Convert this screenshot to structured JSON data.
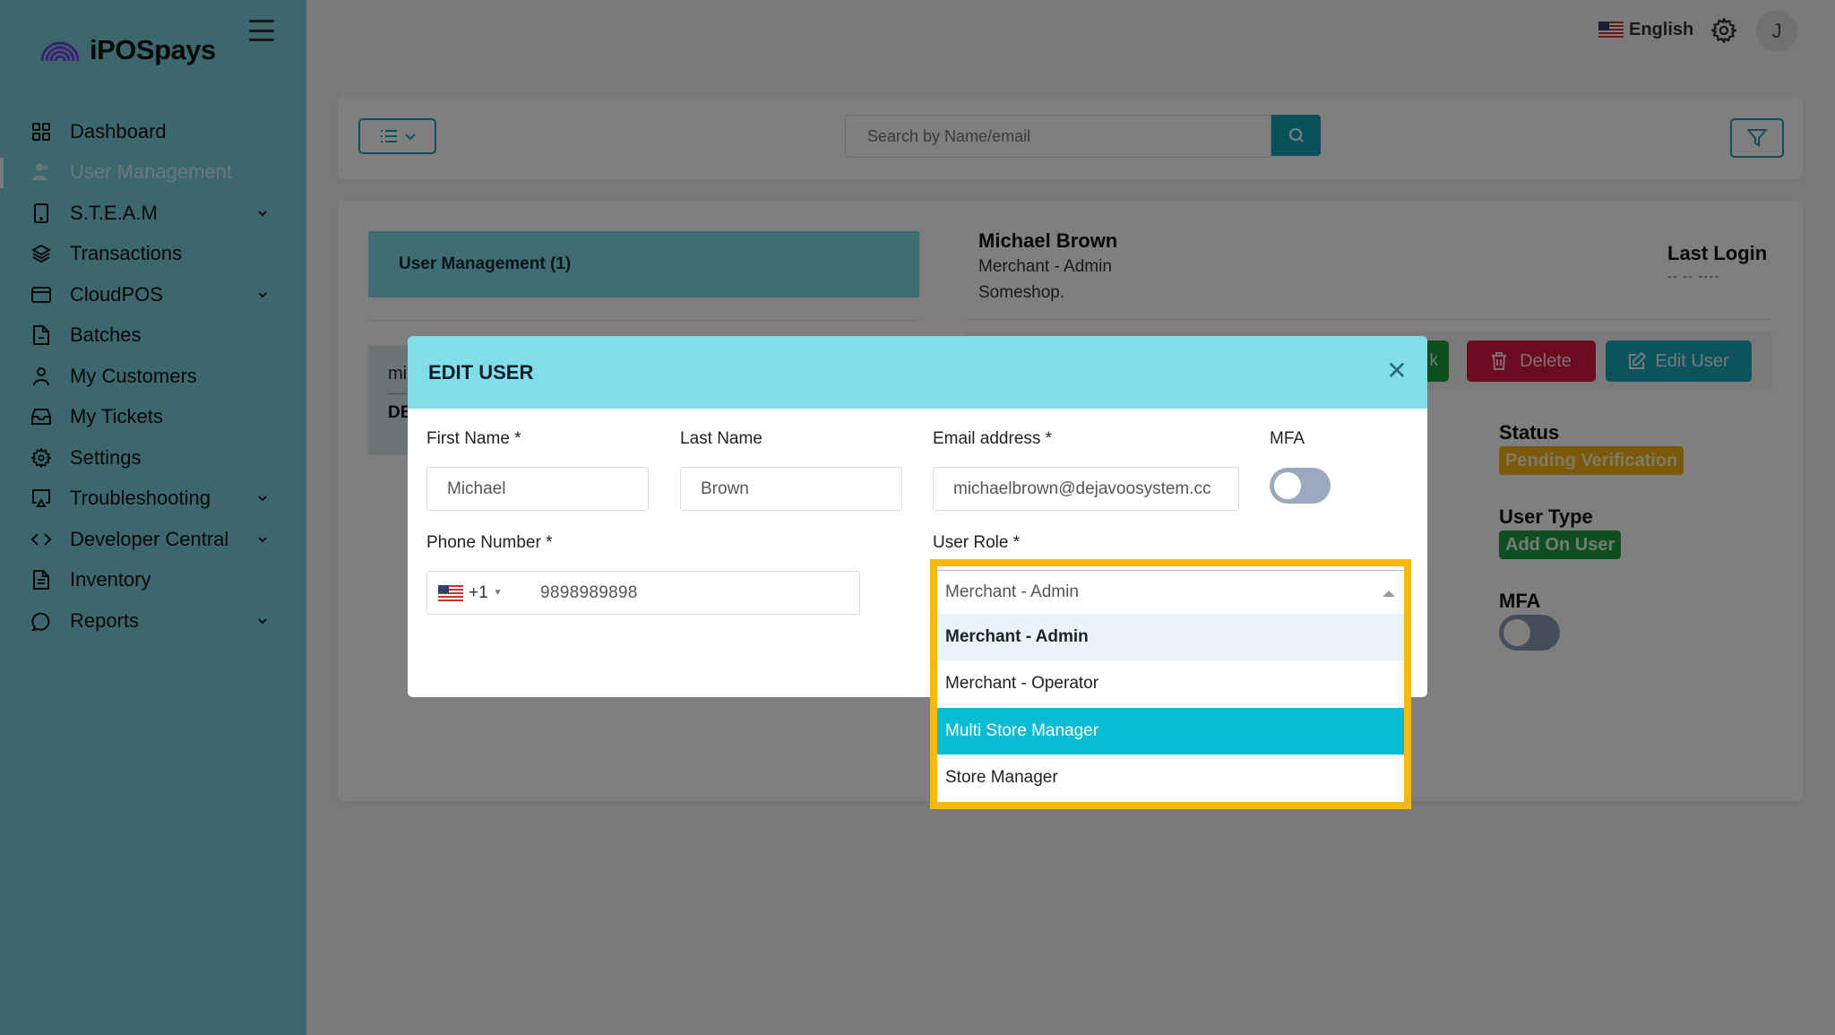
{
  "app": {
    "brand": "iPOSpays",
    "brand_color": "#7b3fe4"
  },
  "sidebar": {
    "items": [
      {
        "label": "Dashboard",
        "icon": "grid-icon",
        "has_children": false,
        "active": false
      },
      {
        "label": "User Management",
        "icon": "users-icon",
        "has_children": false,
        "active": true
      },
      {
        "label": "S.T.E.A.M",
        "icon": "tablet-icon",
        "has_children": true,
        "active": false
      },
      {
        "label": "Transactions",
        "icon": "layers-icon",
        "has_children": false,
        "active": false
      },
      {
        "label": "CloudPOS",
        "icon": "credit-card-icon",
        "has_children": true,
        "active": false
      },
      {
        "label": "Batches",
        "icon": "file-icon",
        "has_children": false,
        "active": false
      },
      {
        "label": "My Customers",
        "icon": "user-icon",
        "has_children": false,
        "active": false
      },
      {
        "label": "My Tickets",
        "icon": "inbox-icon",
        "has_children": false,
        "active": false
      },
      {
        "label": "Settings",
        "icon": "gear-icon",
        "has_children": false,
        "active": false
      },
      {
        "label": "Troubleshooting",
        "icon": "monitor-icon",
        "has_children": true,
        "active": false
      },
      {
        "label": "Developer Central",
        "icon": "code-icon",
        "has_children": true,
        "active": false
      },
      {
        "label": "Inventory",
        "icon": "document-icon",
        "has_children": false,
        "active": false
      },
      {
        "label": "Reports",
        "icon": "chat-bubble-icon",
        "has_children": true,
        "active": false
      }
    ]
  },
  "topbar": {
    "language": "English",
    "avatar_initial": "J"
  },
  "toolbar": {
    "search_placeholder": "Search by Name/email"
  },
  "user_list": {
    "header": "User Management (1)",
    "item_email_partial": "mi",
    "item_meta_partial": "DE"
  },
  "detail": {
    "name": "Michael Brown",
    "role": "Merchant - Admin",
    "shop": "Someshop.",
    "last_login_label": "Last Login",
    "last_login_value": "-- -- ----",
    "unlock_partial": "k",
    "delete_label": "Delete",
    "edit_label": "Edit User",
    "status_label": "Status",
    "status_value": "Pending Verification",
    "user_type_label": "User Type",
    "user_type_value": "Add On User",
    "mfa_label": "MFA",
    "mfa_enabled": false,
    "colors": {
      "status": "#f5b512",
      "user_type": "#1e9e3e",
      "delete": "#d7163f",
      "edit": "#1aa6bd"
    }
  },
  "modal": {
    "title": "EDIT USER",
    "first_name_label": "First Name *",
    "first_name_value": "Michael",
    "last_name_label": "Last Name",
    "last_name_value": "Brown",
    "email_label": "Email address *",
    "email_value": "michaelbrown@dejavoosystem.cc",
    "mfa_label": "MFA",
    "mfa_enabled": false,
    "phone_label": "Phone Number *",
    "phone_country_code": "+1",
    "phone_value": "9898989898",
    "role_label": "User Role *",
    "role_selected": "Merchant - Admin",
    "role_options": [
      "Merchant - Admin",
      "Merchant - Operator",
      "Multi Store Manager",
      "Store Manager"
    ],
    "role_hovered": "Multi Store Manager",
    "header_color": "#80deeb"
  },
  "highlight_color": "#fbb70f"
}
